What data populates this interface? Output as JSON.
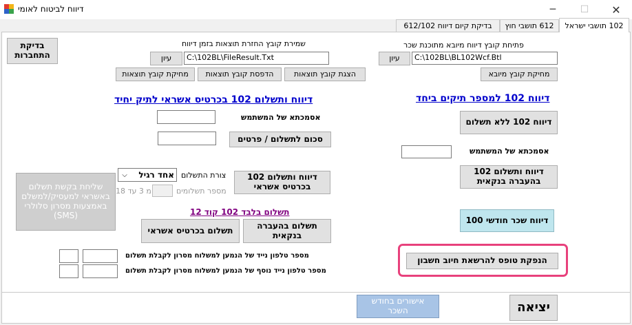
{
  "window": {
    "title": "דיווח לביטוח לאומי",
    "minimize": "─",
    "maximize": "☐",
    "close": "✕"
  },
  "tabs": [
    {
      "label": "102 תושבי ישראל",
      "active": true
    },
    {
      "label": "612 תושבי חוץ",
      "active": false
    },
    {
      "label": "בדיקת קיום דיווח 612/102",
      "active": false
    }
  ],
  "import_file": {
    "label": "פתיחת קובץ דיווח מיובא מתוכנת שכר",
    "path": "C:\\102BL\\BL102Wcf.Btl",
    "browse": "עיון",
    "delete": "מחיקת קובץ מיובא"
  },
  "results_file": {
    "label": "שמירת קובץ החזרת תוצאות בזמן דיווח",
    "path": "C:\\102BL\\FileResult.Txt",
    "browse": "עיון",
    "show": "הצגת קובץ תוצאות",
    "print": "הדפסת קובץ תוצאות",
    "delete": "מחיקת קובץ תוצאות"
  },
  "connection_check": "בדיקת התחברות",
  "section_deductions": {
    "title": "דיווח 102 למספר תיקים ביחד",
    "no_payment": "דיווח 102 ללא תשלום",
    "user_reference_label": "אסמכתא של המשתמש",
    "bank_transfer": "דיווח ותשלום 102 בהעברה בנקאית",
    "monthly_salary": "דיווח שכר חודשי 100",
    "direct_debit": "הנפקת טופס להרשאת חיוב חשבון"
  },
  "section_credit": {
    "title": "דיווח ותשלום 102 בכרטיס אשראי לתיק יחיד",
    "user_reference_label": "אסמכתא של המשתמש",
    "amount_button": "סכום לתשלום / פרטים",
    "report_credit": "דיווח ותשלום 102 בכרטיס אשראי",
    "payment_method_label": "צורת התשלום",
    "payment_method_value": "אחד רגיל",
    "installments_label": "מספר תשלומים",
    "installments_hint": "מ 3 עד 18",
    "payment_only_link": "תשלום בלבד 102 קוד 12",
    "pay_bank": "תשלום בהעברה בנקאית",
    "pay_credit": "תשלום בכרטיס אשראי"
  },
  "sms_button": "שליחת בקשת תשלום באשראי למעסיק/למשלם באמצעות מסרון סלולרי (SMS)",
  "phone1_label": "מספר טלפון נייד של הנמען למשלוח מסרון לקבלת תשלום",
  "phone2_label": "מספר טלפון נייד נוסף של הנמען למשלוח מסרון לקבלת תשלום",
  "footer": {
    "confirmations": "אישורים בחודש השכר",
    "exit": "יציאה"
  },
  "colors": {
    "link": "#0000cc",
    "visited_link": "#800080",
    "highlight": "#e8417c",
    "cyan_button": "#bfe6ee",
    "light_blue_button": "#a8c4e6"
  }
}
